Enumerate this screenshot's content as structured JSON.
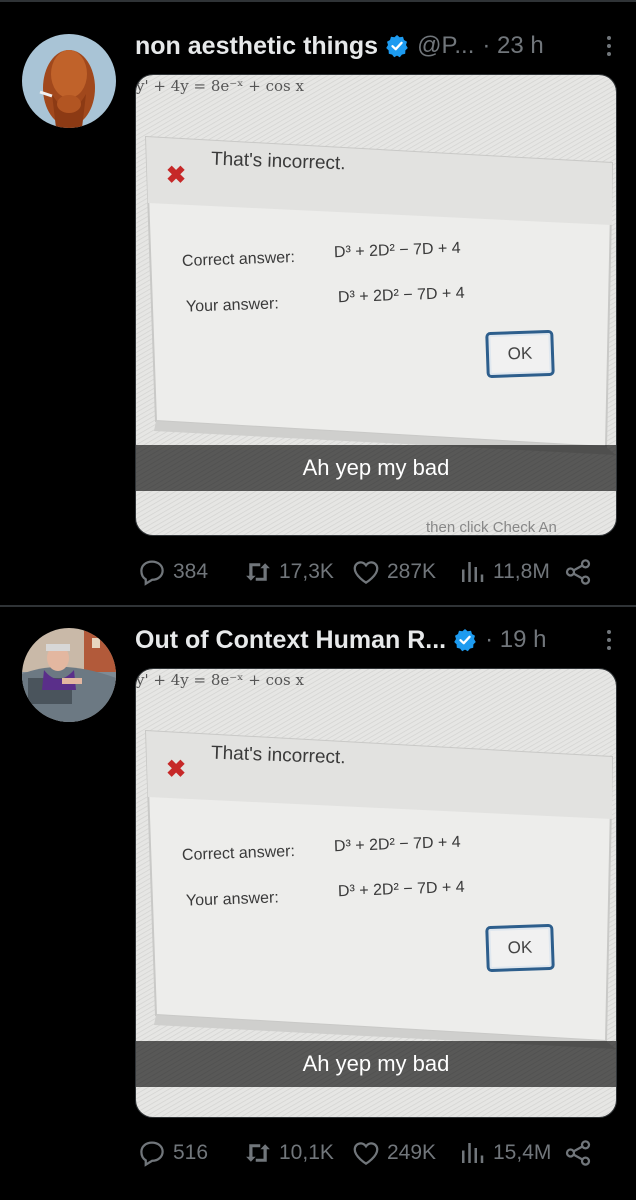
{
  "tweets": [
    {
      "author_name": "non aesthetic things",
      "handle": "@P...",
      "time": "· 23 h",
      "media": {
        "equation": "y' + 4y = 8e⁻ˣ + cos x",
        "error_text": "That's incorrect.",
        "correct_label": "Correct answer:",
        "correct_value": "D³ + 2D² − 7D + 4",
        "your_label": "Your answer:",
        "your_value": "D³ + 2D² − 7D + 4",
        "ok_label": "OK",
        "caption": "Ah yep my bad",
        "bottom_hint": "then click Check An"
      },
      "stats": {
        "replies": "384",
        "reposts": "17,3K",
        "likes": "287K",
        "views": "11,8M"
      }
    },
    {
      "author_name": "Out of Context Human R...",
      "handle": "",
      "time": "· 19 h",
      "media": {
        "equation": "y' + 4y = 8e⁻ˣ + cos x",
        "error_text": "That's incorrect.",
        "correct_label": "Correct answer:",
        "correct_value": "D³ + 2D² − 7D + 4",
        "your_label": "Your answer:",
        "your_value": "D³ + 2D² − 7D + 4",
        "ok_label": "OK",
        "caption": "Ah yep my bad",
        "bottom_hint": ""
      },
      "stats": {
        "replies": "516",
        "reposts": "10,1K",
        "likes": "249K",
        "views": "15,4M"
      }
    }
  ],
  "colors": {
    "verified": "#1d9bf0",
    "muted": "#71767b",
    "text": "#e7e9ea",
    "divider": "#2f3336",
    "error_x": "#c62828"
  },
  "icons": [
    "reply-icon",
    "repost-icon",
    "like-icon",
    "views-icon",
    "share-icon",
    "verified-badge-icon",
    "more-icon"
  ]
}
